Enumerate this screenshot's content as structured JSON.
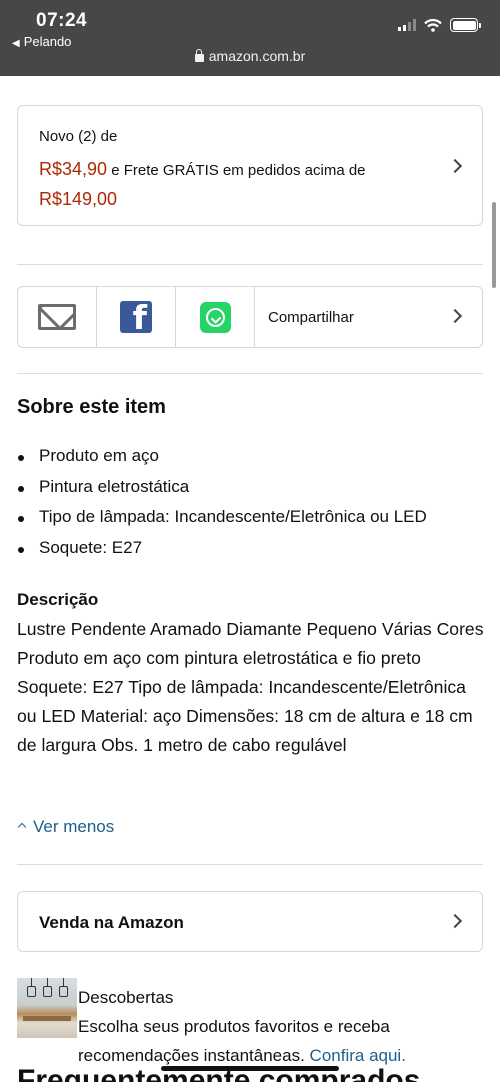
{
  "status_bar": {
    "time": "07:24",
    "back_app": "Pelando",
    "url": "amazon.com.br"
  },
  "offer": {
    "label": "Novo (2) de",
    "price": "R$34,90",
    "shipping": "e Frete GRÁTIS em pedidos acima de",
    "threshold": "R$149,00"
  },
  "share": {
    "label": "Compartilhar",
    "icons": [
      "mail-icon",
      "facebook-icon",
      "whatsapp-icon"
    ]
  },
  "about": {
    "title": "Sobre este item",
    "bullets": [
      "Produto em aço",
      "Pintura eletrostática",
      "Tipo de lâmpada: Incandescente/Eletrônica ou LED",
      "Soquete: E27"
    ],
    "description_title": "Descrição",
    "description": "Lustre Pendente Aramado Diamante Pequeno Várias Cores Produto em aço com pintura eletrostática e fio preto Soquete: E27 Tipo de lâmpada: Incandescente/Eletrônica ou LED Material: aço Dimensões: 18 cm de altura e 18 cm de largura Obs. 1 metro de cabo regulável",
    "see_less": "Ver menos"
  },
  "sell": {
    "label": "Venda na Amazon"
  },
  "discover": {
    "title": "Descobertas",
    "text": "Escolha seus produtos favoritos e receba recomendações instantâneas.",
    "link": "Confira aqui."
  },
  "bottom_heading": "Frequentemente comprados",
  "colors": {
    "price": "#b12704",
    "link": "#1e5e8f",
    "status_bar": "#474747"
  }
}
